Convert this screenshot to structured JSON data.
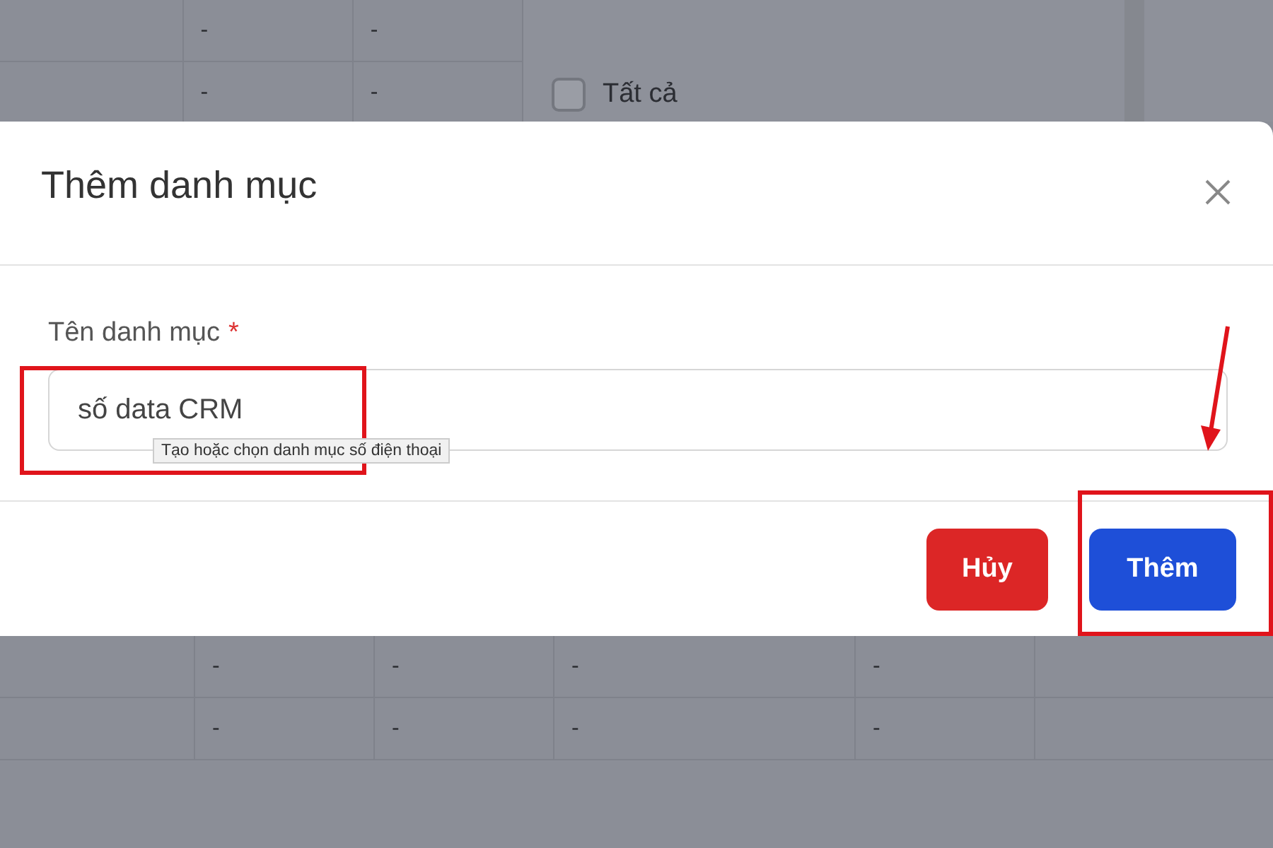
{
  "background_table": {
    "top_rows": [
      {
        "cells": [
          "-",
          "-"
        ]
      },
      {
        "cells": [
          "-",
          "-"
        ]
      }
    ],
    "bottom_rows": [
      {
        "cells": [
          "-",
          "-",
          "-",
          "-"
        ]
      },
      {
        "cells": [
          "-",
          "-",
          "-",
          "-"
        ]
      }
    ]
  },
  "filter": {
    "label": "Tất cả",
    "checked": false
  },
  "dialog": {
    "title": "Thêm danh mục",
    "field": {
      "label": "Tên danh mục",
      "required_mark": "*",
      "value": "số data CRM"
    },
    "tooltip": "Tạo hoặc chọn danh mục số điện thoại",
    "buttons": [
      {
        "label": "Hủy",
        "kind": "cancel"
      },
      {
        "label": "Thêm",
        "kind": "primary"
      }
    ]
  },
  "annotations": [
    {
      "kind": "frame"
    },
    {
      "kind": "frame"
    },
    {
      "kind": "arrow"
    }
  ]
}
